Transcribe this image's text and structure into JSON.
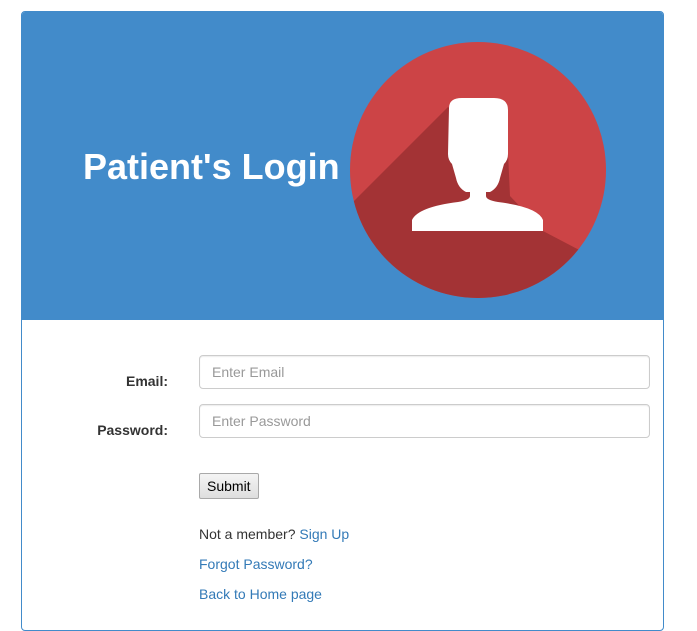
{
  "header": {
    "title": "Patient's Login",
    "background_color": "#428bca",
    "avatar_icon": "user-icon",
    "avatar_circle_color": "#cc4446",
    "avatar_shadow_color": "#a33335"
  },
  "form": {
    "email": {
      "label": "Email:",
      "placeholder": "Enter Email",
      "value": ""
    },
    "password": {
      "label": "Password:",
      "placeholder": "Enter Password",
      "value": ""
    },
    "submit_label": "Submit"
  },
  "links": {
    "not_member_text": "Not a member?",
    "sign_up_label": "Sign Up",
    "forgot_password_label": "Forgot Password?",
    "back_home_label": "Back to Home page",
    "link_color": "#337ab7"
  }
}
